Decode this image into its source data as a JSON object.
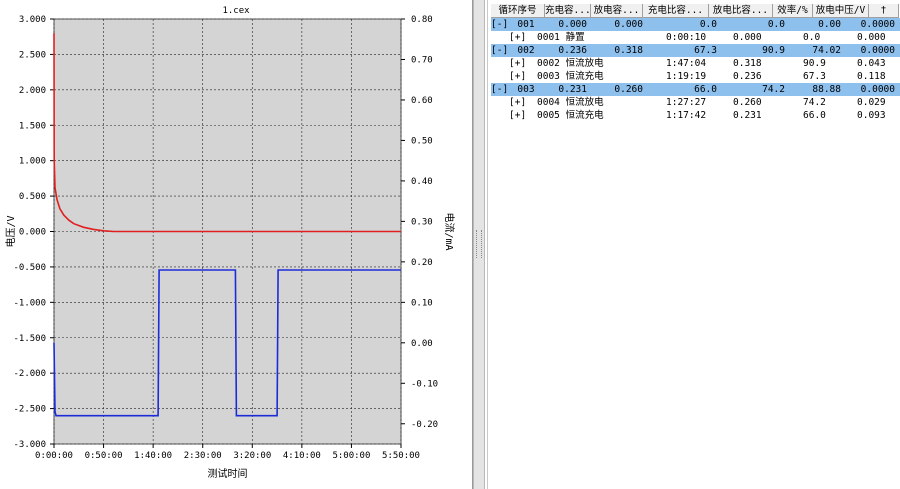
{
  "chart": {
    "file_title": "1.cex",
    "left_axis_label": "电压/V",
    "right_axis_label": "电流/mA",
    "x_axis_label": "测试时间",
    "left_ticks": [
      "3.000",
      "2.500",
      "2.000",
      "1.500",
      "1.000",
      "0.500",
      "0.000",
      "-0.500",
      "-1.000",
      "-1.500",
      "-2.000",
      "-2.500",
      "-3.000"
    ],
    "right_ticks": [
      "0.80",
      "0.70",
      "0.60",
      "0.50",
      "0.40",
      "0.30",
      "0.20",
      "0.10",
      "0.00",
      "-0.10",
      "-0.20"
    ],
    "x_ticks": [
      "0:00:00",
      "0:50:00",
      "1:40:00",
      "2:30:00",
      "3:20:00",
      "4:10:00",
      "5:00:00",
      "5:50:00"
    ],
    "background_color": "#d4d4d4",
    "voltage_color": "#e02020",
    "current_color": "#1c2bd8"
  },
  "chart_data": {
    "type": "line",
    "xlabel": "测试时间",
    "ylabel": "电压/V",
    "y2label": "电流/mA",
    "xlim_min": [
      0,
      350
    ],
    "ylim": [
      -3.0,
      3.0
    ],
    "y2lim": [
      -0.25,
      0.8
    ],
    "grid": true,
    "series": [
      {
        "axis": "left",
        "x_min": [
          0,
          0.2,
          1,
          3,
          6,
          10,
          15,
          20,
          30,
          40,
          50,
          60,
          70,
          78,
          80,
          100,
          120,
          130,
          134,
          136,
          137,
          138,
          140,
          145,
          150,
          160,
          170,
          180,
          200,
          220,
          225,
          227,
          230,
          240,
          250,
          260,
          270,
          280,
          290,
          300,
          310,
          320,
          330,
          340,
          345,
          350
        ],
        "y": [
          2.8,
          1.0,
          0.62,
          0.45,
          0.32,
          0.23,
          0.16,
          0.11,
          0.06,
          0.03,
          0.01,
          0.0,
          0.0,
          0.0,
          0.0,
          0.0,
          0.0,
          0.0,
          0.0,
          0.0,
          0.0,
          0.0,
          0.0,
          0.0,
          0.0,
          0.0,
          0.0,
          0.0,
          0.0,
          0.0,
          0.0,
          0.0,
          0.0,
          0.0,
          0.0,
          0.0,
          0.0,
          0.0,
          0.0,
          0.0,
          0.0,
          0.0,
          0.0,
          0.0,
          0.0,
          0.0
        ]
      },
      {
        "axis": "right",
        "x_min": [
          0,
          1,
          2,
          40,
          80,
          105,
          106,
          140,
          183,
          184,
          190,
          210,
          225,
          226,
          240,
          270,
          300,
          330,
          350
        ],
        "y": [
          0.0,
          -0.17,
          -0.18,
          -0.18,
          -0.18,
          -0.18,
          0.18,
          0.18,
          0.18,
          -0.18,
          -0.18,
          -0.18,
          -0.18,
          0.18,
          0.18,
          0.18,
          0.18,
          0.18,
          0.18
        ]
      }
    ]
  },
  "table": {
    "headers": [
      "循环序号",
      "充电容...",
      "放电容...",
      "充电比容...",
      "放电比容...",
      "效率/%",
      "放电中压/V",
      "†"
    ],
    "rows": [
      {
        "kind": "cycle",
        "toggle": "[-]",
        "id": "001",
        "charge_cap": "0.000",
        "discharge_cap": "0.000",
        "charge_spec": "0.0",
        "discharge_spec": "0.0",
        "efficiency": "0.00",
        "mid_voltage": "0.0000"
      },
      {
        "kind": "step",
        "toggle": "[+]",
        "step": "0001 静置",
        "time": "0:00:10",
        "cap": "0.000",
        "spec": "0.0",
        "extra": "0.000"
      },
      {
        "kind": "cycle",
        "toggle": "[-]",
        "id": "002",
        "charge_cap": "0.236",
        "discharge_cap": "0.318",
        "charge_spec": "67.3",
        "discharge_spec": "90.9",
        "efficiency": "74.02",
        "mid_voltage": "0.0000"
      },
      {
        "kind": "step",
        "toggle": "[+]",
        "step": "0002 恒流放电",
        "time": "1:47:04",
        "cap": "0.318",
        "spec": "90.9",
        "extra": "0.043"
      },
      {
        "kind": "step",
        "toggle": "[+]",
        "step": "0003 恒流充电",
        "time": "1:19:19",
        "cap": "0.236",
        "spec": "67.3",
        "extra": "0.118"
      },
      {
        "kind": "cycle",
        "toggle": "[-]",
        "id": "003",
        "charge_cap": "0.231",
        "discharge_cap": "0.260",
        "charge_spec": "66.0",
        "discharge_spec": "74.2",
        "efficiency": "88.88",
        "mid_voltage": "0.0000"
      },
      {
        "kind": "step",
        "toggle": "[+]",
        "step": "0004 恒流放电",
        "time": "1:27:27",
        "cap": "0.260",
        "spec": "74.2",
        "extra": "0.029"
      },
      {
        "kind": "step",
        "toggle": "[+]",
        "step": "0005 恒流充电",
        "time": "1:17:42",
        "cap": "0.231",
        "spec": "66.0",
        "extra": "0.093"
      }
    ]
  }
}
